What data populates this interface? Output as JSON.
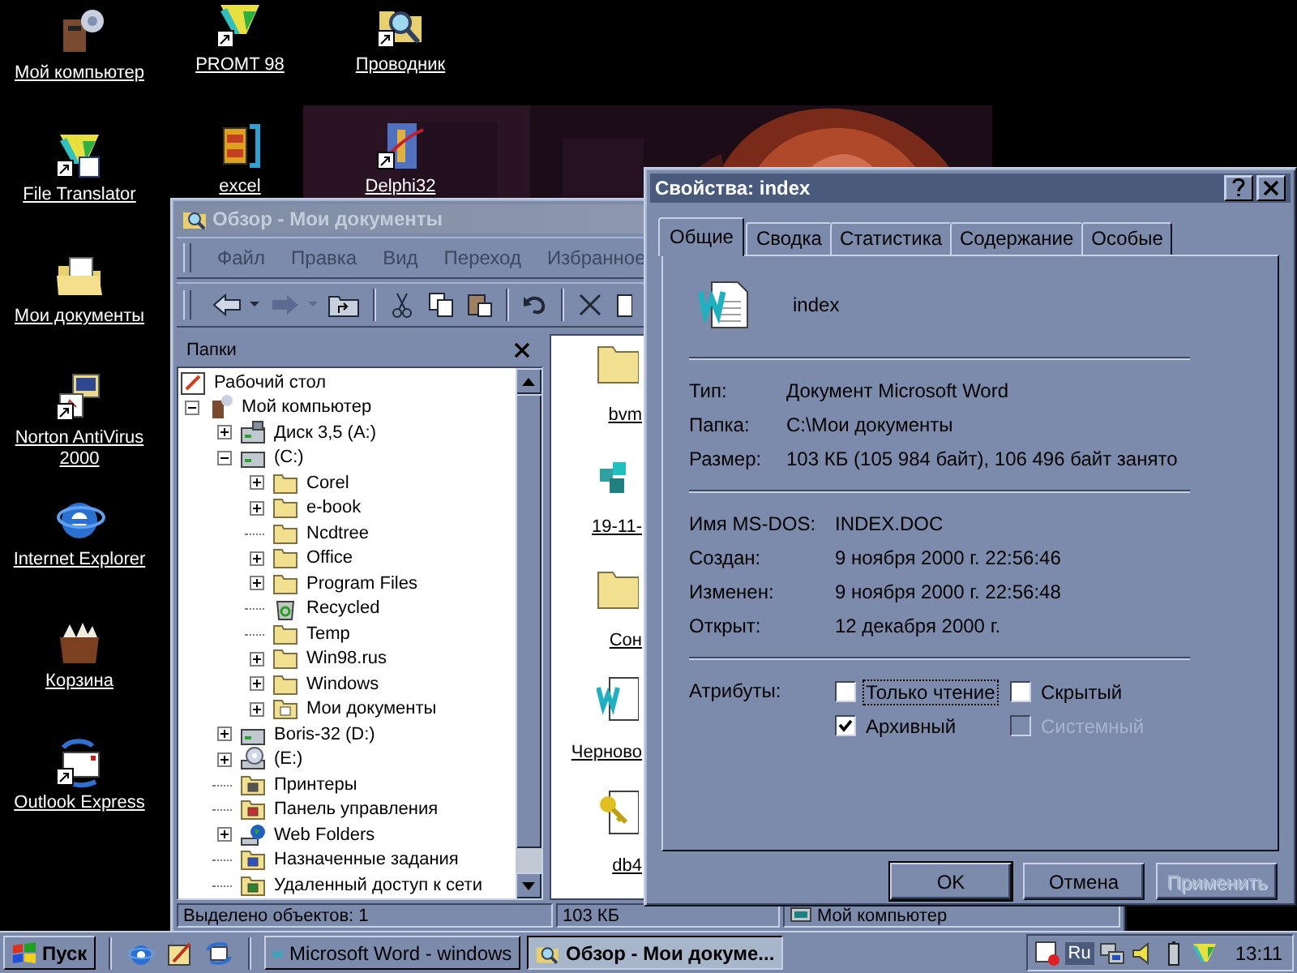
{
  "desktop": {
    "icon_columns": [
      {
        "icons": [
          {
            "label": "Мой компьютер",
            "kind": "computer",
            "shortcut": false
          },
          {
            "label": "File Translator",
            "kind": "translator",
            "shortcut": true
          },
          {
            "label": "Мои документы",
            "kind": "mydocs",
            "shortcut": false
          },
          {
            "label": "Norton AntiVirus 2000",
            "kind": "norton",
            "shortcut": true
          },
          {
            "label": "Internet Explorer",
            "kind": "ie",
            "shortcut": false
          },
          {
            "label": "Корзина",
            "kind": "basket",
            "shortcut": false
          },
          {
            "label": "Outlook Express",
            "kind": "outlook",
            "shortcut": true
          }
        ]
      },
      {
        "icons": [
          {
            "label": "PROMT 98",
            "kind": "promt",
            "shortcut": true
          },
          {
            "label": "excel",
            "kind": "cabinet",
            "shortcut": false
          }
        ]
      },
      {
        "icons": [
          {
            "label": "Проводник",
            "kind": "explorer",
            "shortcut": true
          },
          {
            "label": "Delphi32",
            "kind": "delphi",
            "shortcut": true
          }
        ]
      }
    ]
  },
  "explorer": {
    "title": "Обзор - Мои документы",
    "active": false,
    "menu": [
      "Файл",
      "Правка",
      "Вид",
      "Переход",
      "Избранное"
    ],
    "folders_title": "Папки",
    "tree": [
      {
        "label": "Рабочий стол",
        "kind": "desktop",
        "children": [
          {
            "label": "Мой компьютер",
            "kind": "computer",
            "expanded": true,
            "children": [
              {
                "label": "Диск 3,5 (A:)",
                "kind": "floppy",
                "expanded": false
              },
              {
                "label": "(C:)",
                "kind": "drive",
                "expanded": true,
                "children": [
                  {
                    "label": "Corel",
                    "kind": "folder",
                    "expanded": false
                  },
                  {
                    "label": "e-book",
                    "kind": "folder",
                    "expanded": false
                  },
                  {
                    "label": "Ncdtree",
                    "kind": "folder"
                  },
                  {
                    "label": "Office",
                    "kind": "folder",
                    "expanded": false
                  },
                  {
                    "label": "Program Files",
                    "kind": "folder",
                    "expanded": false
                  },
                  {
                    "label": "Recycled",
                    "kind": "recycle"
                  },
                  {
                    "label": "Temp",
                    "kind": "folder"
                  },
                  {
                    "label": "Win98.rus",
                    "kind": "folder",
                    "expanded": false
                  },
                  {
                    "label": "Windows",
                    "kind": "folder",
                    "expanded": false
                  },
                  {
                    "label": "Мои документы",
                    "kind": "mydocs",
                    "expanded": false
                  }
                ]
              },
              {
                "label": "Boris-32 (D:)",
                "kind": "drive",
                "expanded": false
              },
              {
                "label": "(E:)",
                "kind": "cd",
                "expanded": false
              },
              {
                "label": "Принтеры",
                "kind": "printers"
              },
              {
                "label": "Панель управления",
                "kind": "control"
              },
              {
                "label": "Web Folders",
                "kind": "web",
                "expanded": false
              },
              {
                "label": "Назначенные задания",
                "kind": "tasks"
              },
              {
                "label": "Удаленный доступ к сети",
                "kind": "dialup"
              }
            ]
          }
        ]
      }
    ],
    "files": [
      {
        "label": "bvm",
        "kind": "folder"
      },
      {
        "label": "19-11-",
        "kind": "cubes"
      },
      {
        "label": "Сон",
        "kind": "folder"
      },
      {
        "label": "Черново",
        "kind": "word"
      },
      {
        "label": "db4",
        "kind": "keydoc"
      }
    ],
    "status_bar": [
      "Выделено объектов: 1",
      "103 КБ",
      "Мой компьютер"
    ]
  },
  "dialog": {
    "title": "Свойства: index",
    "tabs": [
      {
        "label": "Общие",
        "selected": true
      },
      {
        "label": "Сводка",
        "selected": false
      },
      {
        "label": "Статистика",
        "selected": false
      },
      {
        "label": "Содержание",
        "selected": false
      },
      {
        "label": "Особые",
        "selected": false
      }
    ],
    "file_name": "index",
    "info": [
      {
        "label": "Тип:",
        "value": "Документ Microsoft Word"
      },
      {
        "label": "Папка:",
        "value": "C:\\Мои документы"
      },
      {
        "label": "Размер:",
        "value": "103 КБ (105 984 байт), 106 496 байт занято"
      }
    ],
    "dates": [
      {
        "label": "Имя MS-DOS:",
        "value": "INDEX.DOC"
      },
      {
        "label": "Создан:",
        "value": "9 ноября 2000 г. 22:56:46"
      },
      {
        "label": "Изменен:",
        "value": "9 ноября 2000 г. 22:56:48"
      },
      {
        "label": "Открыт:",
        "value": "12 декабря 2000 г."
      }
    ],
    "attributes_label": "Атрибуты:",
    "attributes": [
      {
        "label": "Только чтение",
        "checked": false,
        "disabled": false,
        "focused": true
      },
      {
        "label": "Скрытый",
        "checked": false,
        "disabled": false,
        "focused": false
      },
      {
        "label": "Архивный",
        "checked": true,
        "disabled": false,
        "focused": false
      },
      {
        "label": "Системный",
        "checked": false,
        "disabled": true,
        "focused": false
      }
    ],
    "buttons": [
      {
        "label": "OK",
        "default": true,
        "disabled": false
      },
      {
        "label": "Отмена",
        "default": false,
        "disabled": false
      },
      {
        "label": "Применить",
        "default": false,
        "disabled": true
      }
    ]
  },
  "taskbar": {
    "start": "Пуск",
    "tasks": [
      {
        "label": "Microsoft Word - windows",
        "kind": "word",
        "selected": false
      },
      {
        "label": "Обзор - Мои докуме...",
        "kind": "explorer",
        "selected": true
      }
    ],
    "language": "Ru",
    "clock": "13:11"
  }
}
